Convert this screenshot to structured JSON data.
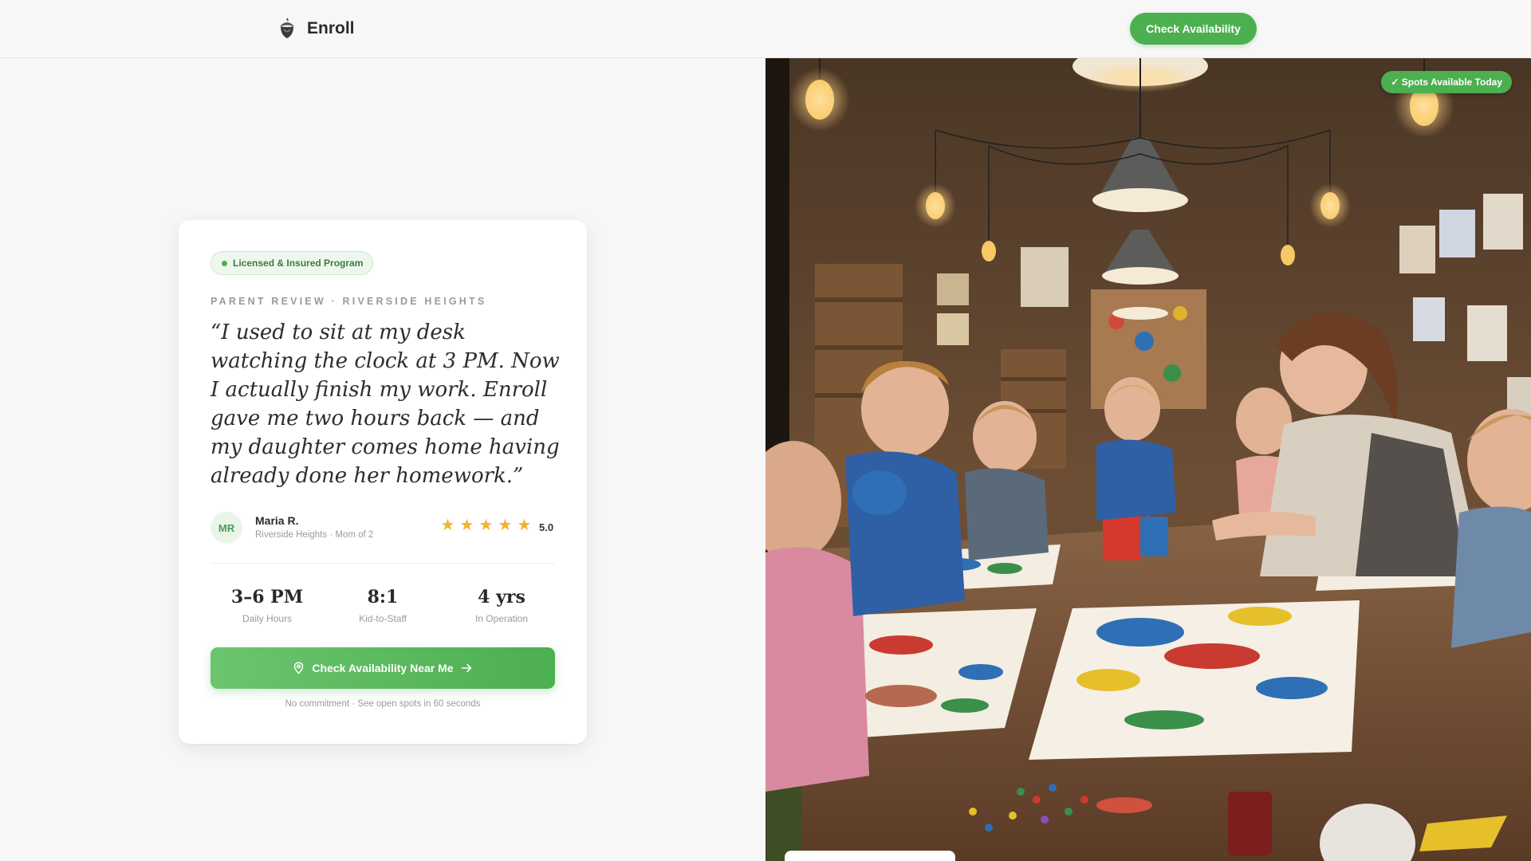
{
  "brand": {
    "name": "Enroll",
    "logo_icon": "acorn-icon"
  },
  "nav": {
    "cta_label": "Check Availability"
  },
  "review": {
    "badge": "Licensed & Insured Program",
    "eyebrow": "PARENT REVIEW · RIVERSIDE HEIGHTS",
    "quote": "“I used to sit at my desk watching the clock at 3 PM. Now I actually finish my work. Enroll gave me two hours back — and my daughter comes home having already done her homework.”",
    "author": {
      "initials": "MR",
      "name": "Maria R.",
      "meta": "Riverside Heights · Mom of 2"
    },
    "rating": {
      "stars": 5,
      "value": "5.0"
    }
  },
  "stats": [
    {
      "value": "3–6 PM",
      "label": "Daily Hours"
    },
    {
      "value": "8:1",
      "label": "Kid-to-Staff"
    },
    {
      "value": "4 yrs",
      "label": "In Operation"
    }
  ],
  "cta": {
    "label": "Check Availability Near Me",
    "note": "No commitment · See open spots in 60 seconds",
    "icon_left": "location-pin-icon",
    "icon_right": "arrow-right-icon"
  },
  "hero": {
    "badge": "✓ Spots Available Today",
    "accent": "#4caf50"
  }
}
